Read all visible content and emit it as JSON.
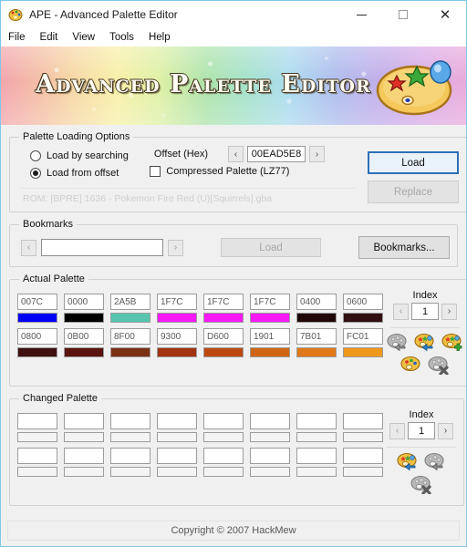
{
  "window": {
    "title": "APE - Advanced Palette Editor",
    "app_icon": "palette-icon",
    "minimize_label": "–",
    "maximize_label": "□",
    "close_label": "✕"
  },
  "menu": {
    "items": [
      {
        "label": "File"
      },
      {
        "label": "Edit"
      },
      {
        "label": "View"
      },
      {
        "label": "Tools"
      },
      {
        "label": "Help"
      }
    ]
  },
  "banner": {
    "title": "Advanced Palette Editor",
    "icon": "artist-palette-icon"
  },
  "loading_options": {
    "legend": "Palette Loading Options",
    "radio_search_label": "Load by searching",
    "radio_search_checked": false,
    "radio_offset_label": "Load from offset",
    "radio_offset_checked": true,
    "offset_label": "Offset (Hex)",
    "offset_prev": "‹",
    "offset_next": "›",
    "offset_value": "00EAD5E8",
    "compressed_label": "Compressed Palette (LZ77)",
    "compressed_checked": false,
    "rom_text": "ROM: [BPRE] 1636 - Pokemon Fire Red (U)[Squirrels].gba",
    "load_button": "Load",
    "replace_button": "Replace",
    "replace_disabled": true,
    "load_focus_color": "#2f6fb5"
  },
  "bookmarks": {
    "legend": "Bookmarks",
    "prev": "‹",
    "next": "›",
    "field_value": "",
    "field_placeholder": "",
    "load_button": "Load",
    "load_disabled": true,
    "open_button": "Bookmarks..."
  },
  "actual_palette": {
    "legend": "Actual Palette",
    "index_label": "Index",
    "index_prev": "‹",
    "index_next": "›",
    "index_value": "1",
    "icons": [
      {
        "name": "palette-prev-icon",
        "state": "disabled"
      },
      {
        "name": "palette-apply-icon",
        "state": "enabled"
      },
      {
        "name": "palette-add-icon",
        "state": "enabled"
      },
      {
        "name": "palette-edit-icon",
        "state": "enabled"
      },
      {
        "name": "palette-delete-icon",
        "state": "disabled"
      }
    ],
    "rows": [
      [
        {
          "hex": "007C",
          "color": "#0000f8"
        },
        {
          "hex": "0000",
          "color": "#000000"
        },
        {
          "hex": "2A5B",
          "color": "#58c4b0"
        },
        {
          "hex": "1F7C",
          "color": "#f818f8"
        },
        {
          "hex": "1F7C",
          "color": "#f818f8"
        },
        {
          "hex": "1F7C",
          "color": "#f818f8"
        },
        {
          "hex": "0400",
          "color": "#200808"
        },
        {
          "hex": "0600",
          "color": "#301010"
        }
      ],
      [
        {
          "hex": "0800",
          "color": "#401010"
        },
        {
          "hex": "0B00",
          "color": "#5a1410"
        },
        {
          "hex": "8F00",
          "color": "#7c3014"
        },
        {
          "hex": "9300",
          "color": "#a03410"
        },
        {
          "hex": "D600",
          "color": "#bc4810"
        },
        {
          "hex": "1901",
          "color": "#d06414"
        },
        {
          "hex": "7B01",
          "color": "#e07818"
        },
        {
          "hex": "FC01",
          "color": "#f0981c"
        }
      ]
    ]
  },
  "changed_palette": {
    "legend": "Changed Palette",
    "index_label": "Index",
    "index_prev": "‹",
    "index_next": "›",
    "index_value": "1",
    "icons": [
      {
        "name": "palette-apply-icon",
        "state": "enabled"
      },
      {
        "name": "palette-prev-icon",
        "state": "disabled"
      },
      {
        "name": "palette-delete-icon",
        "state": "disabled"
      }
    ],
    "rows": [
      [
        {
          "hex": "",
          "color": ""
        },
        {
          "hex": "",
          "color": ""
        },
        {
          "hex": "",
          "color": ""
        },
        {
          "hex": "",
          "color": ""
        },
        {
          "hex": "",
          "color": ""
        },
        {
          "hex": "",
          "color": ""
        },
        {
          "hex": "",
          "color": ""
        },
        {
          "hex": "",
          "color": ""
        }
      ],
      [
        {
          "hex": "",
          "color": ""
        },
        {
          "hex": "",
          "color": ""
        },
        {
          "hex": "",
          "color": ""
        },
        {
          "hex": "",
          "color": ""
        },
        {
          "hex": "",
          "color": ""
        },
        {
          "hex": "",
          "color": ""
        },
        {
          "hex": "",
          "color": ""
        },
        {
          "hex": "",
          "color": ""
        }
      ]
    ]
  },
  "statusbar": {
    "copyright": "Copyright © 2007 HackMew"
  }
}
